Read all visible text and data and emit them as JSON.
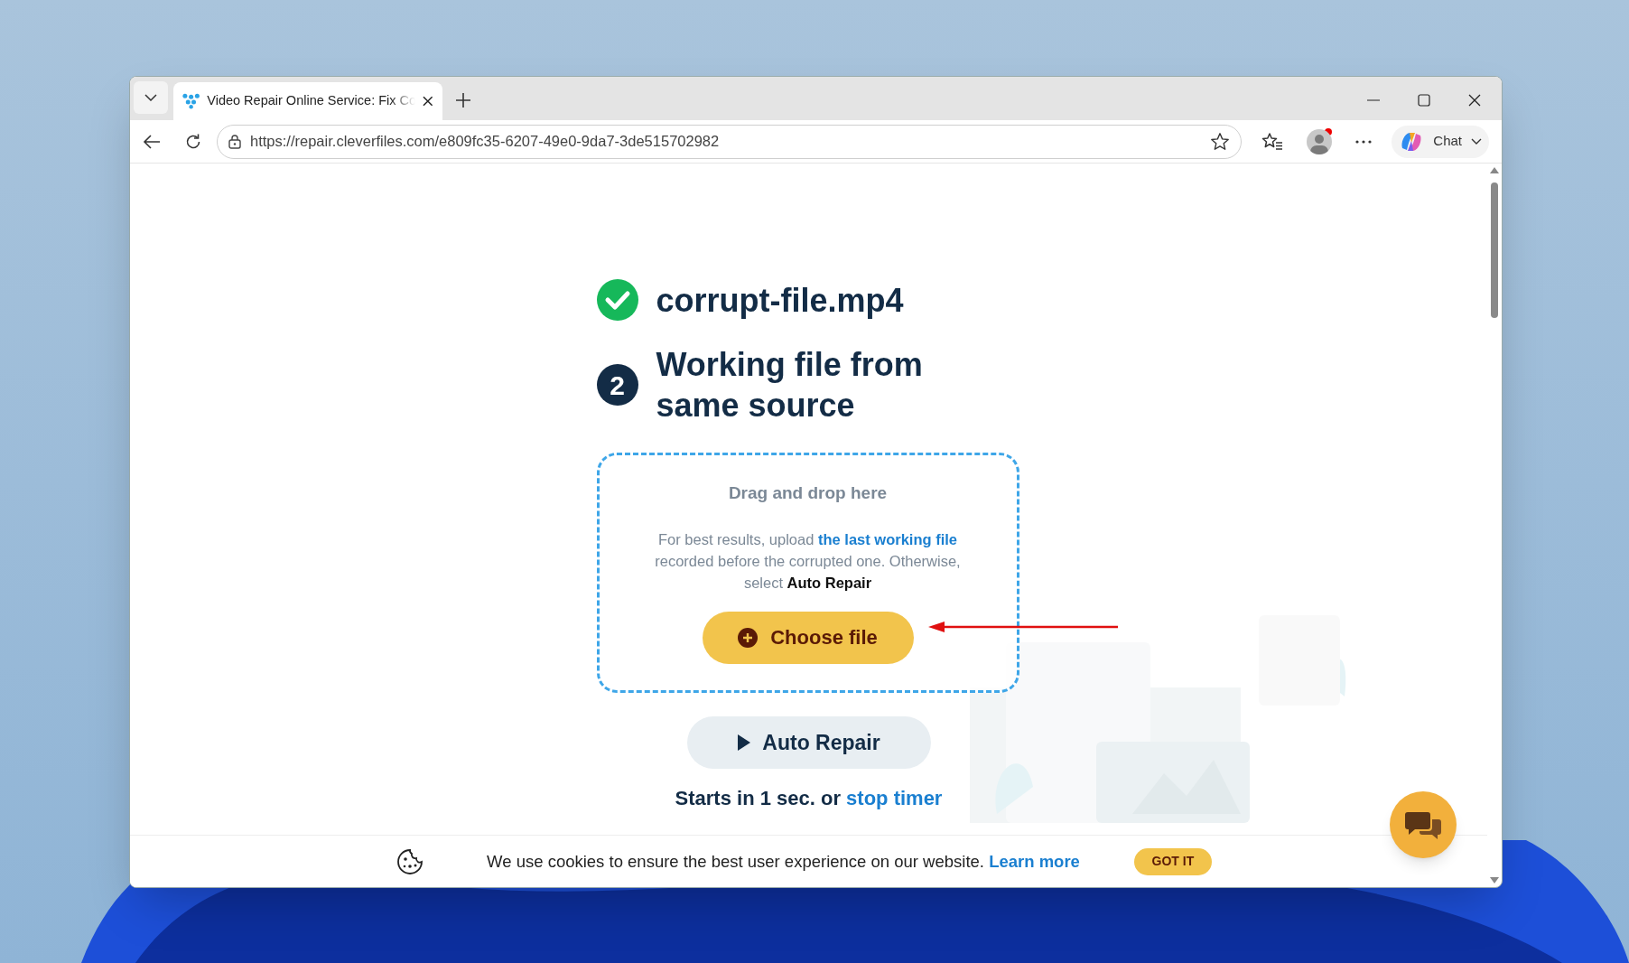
{
  "browser": {
    "tab": {
      "title": "Video Repair Online Service: Fix Co",
      "selected": true
    },
    "address": "https://repair.cleverfiles.com/e809fc35-6207-49e0-9da7-3de515702982",
    "chat_button": "Chat",
    "profile_notification": true
  },
  "steps": [
    {
      "kind": "done",
      "title": "corrupt-file.mp4"
    },
    {
      "kind": "number",
      "number": "2",
      "title": "Working file from same source"
    }
  ],
  "dropzone": {
    "title": "Drag and drop here",
    "hint": [
      {
        "kind": "plain",
        "text": "For best results, upload "
      },
      {
        "kind": "link",
        "text": "the last working file"
      },
      {
        "kind": "plain",
        "text": " recorded before the corrupted one. Otherwise, select "
      },
      {
        "kind": "bold",
        "text": "Auto Repair"
      }
    ],
    "choose_button": "Choose file"
  },
  "auto_repair_button": "Auto Repair",
  "timer": {
    "text": "Starts in 1 sec. or ",
    "link": "stop timer"
  },
  "cookie_bar": {
    "text": "We use cookies to ensure the best user experience on our website.",
    "link": "Learn more",
    "button": "GOT IT"
  }
}
